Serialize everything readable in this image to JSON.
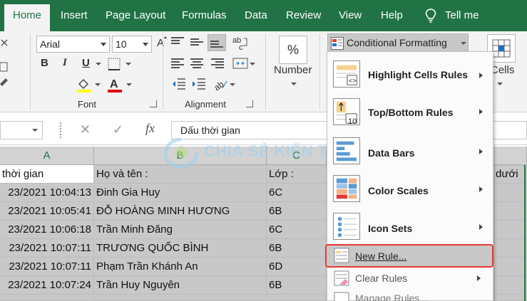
{
  "ribbon": {
    "tabs": [
      "Home",
      "Insert",
      "Page Layout",
      "Formulas",
      "Data",
      "Review",
      "View",
      "Help",
      "Tell me"
    ],
    "font_name": "Arial",
    "font_size": "10",
    "bold": "B",
    "italic": "I",
    "underline": "U",
    "font_group": "Font",
    "alignment_group": "Alignment",
    "number_label": "Number",
    "percent": "%",
    "cond_formatting": "Conditional Formatting",
    "cells_label": "Cells"
  },
  "formula_bar": {
    "cancel": "✕",
    "enter": "✓",
    "fx": "fx",
    "content": "Dấu thời gian"
  },
  "watermark": "CHIA SẺ KIẾN THỨC",
  "sheet": {
    "col_headers": [
      "A",
      "B",
      "C"
    ],
    "header_row": [
      "thời gian",
      "Họ và tên :",
      "Lớp :",
      "dưới"
    ],
    "rows": [
      [
        "23/2021 10:04:13",
        "Đinh Gia Huy",
        "6C"
      ],
      [
        "23/2021 10:05:41",
        "ĐỖ HOÀNG MINH HƯƠNG",
        "6B"
      ],
      [
        "23/2021 10:06:18",
        "Trần Minh Đăng",
        "6C"
      ],
      [
        "23/2021 10:07:11",
        "TRƯƠNG QUỐC BÌNH",
        "6B"
      ],
      [
        "23/2021 10:07:11",
        "Phạm Trần Khánh An",
        "6D"
      ],
      [
        "23/2021 10:07:24",
        "Trần Huy Nguyên",
        "6B"
      ],
      [
        "",
        "",
        ""
      ]
    ]
  },
  "menu": {
    "items": [
      {
        "label": "Highlight Cells Rules",
        "icon": "highlight-cells-icon"
      },
      {
        "label": "Top/Bottom Rules",
        "icon": "top-bottom-icon"
      },
      {
        "label": "Data Bars",
        "icon": "data-bars-icon"
      },
      {
        "label": "Color Scales",
        "icon": "color-scales-icon"
      },
      {
        "label": "Icon Sets",
        "icon": "icon-sets-icon"
      }
    ],
    "new_rule": "New Rule...",
    "clear_rules": "Clear Rules",
    "manage_rules": "Manage Rules...",
    "top_bottom_num": "10"
  },
  "colors": {
    "excel_green": "#217346",
    "highlight_red": "#e53935",
    "font_color_red": "#e00000",
    "fill_yellow": "#ffff00"
  }
}
